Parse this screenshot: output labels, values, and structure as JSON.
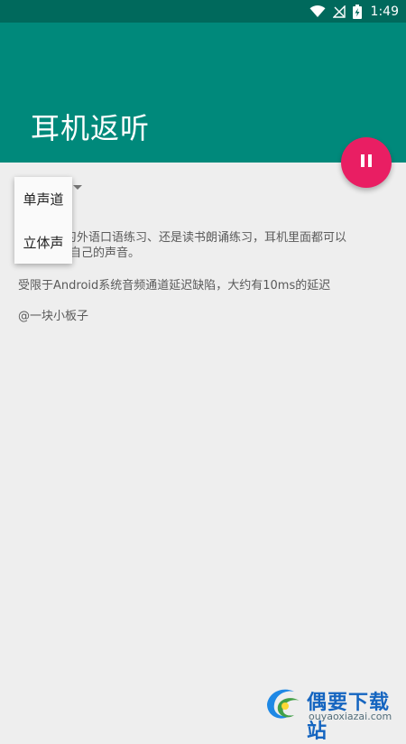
{
  "status_bar": {
    "time": "1:49",
    "icons": [
      "wifi-icon",
      "no-signal-icon",
      "battery-charging-icon"
    ]
  },
  "app_bar": {
    "title": "耳机返听",
    "background": "#00897b",
    "status_background": "#00695c"
  },
  "fab": {
    "icon": "pause-icon",
    "color": "#e91e63"
  },
  "channel_menu": {
    "items": [
      {
        "label": "单声道"
      },
      {
        "label": "立体声"
      }
    ]
  },
  "content": {
    "description_line1": "学习外语口语练习、还是读书朗诵练习，耳机里面都可以",
    "description_line2": "自己的声音。",
    "latency_note": "受限于Android系统音频通道延迟缺陷，大约有10ms的延迟",
    "author": "@一块小板子"
  },
  "watermark": {
    "title": "偶要下载站",
    "url": "ouyaoxiazai.com"
  }
}
